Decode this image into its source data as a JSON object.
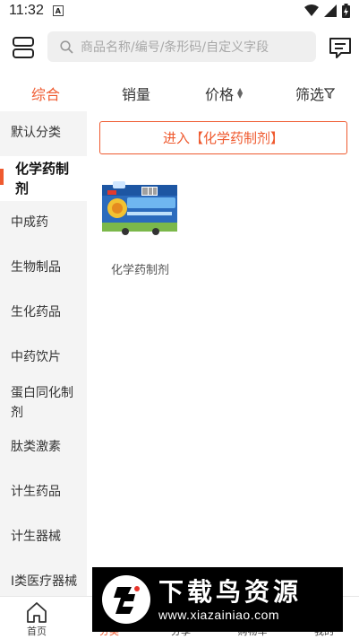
{
  "status_bar": {
    "time": "11:32",
    "app_badge": "A"
  },
  "header": {
    "search_placeholder": "商品名称/编号/条形码/自定义字段"
  },
  "sort_tabs": [
    {
      "label": "综合",
      "active": true
    },
    {
      "label": "销量",
      "active": false
    },
    {
      "label": "价格",
      "active": false
    },
    {
      "label": "筛选",
      "active": false
    }
  ],
  "categories": [
    {
      "label": "默认分类"
    },
    {
      "label": "化学药制剂",
      "active": true
    },
    {
      "label": "中成药"
    },
    {
      "label": "生物制品"
    },
    {
      "label": "生化药品"
    },
    {
      "label": "中药饮片"
    },
    {
      "label": "蛋白同化制剂"
    },
    {
      "label": "肽类激素"
    },
    {
      "label": "计生药品"
    },
    {
      "label": "计生器械"
    },
    {
      "label": "I类医疗器械"
    }
  ],
  "content": {
    "enter_label": "进入【化学药制剂】",
    "product_name": "化学药制剂"
  },
  "bottom_nav": [
    {
      "label": "首页"
    },
    {
      "label": "分类",
      "active": true
    },
    {
      "label": "分享"
    },
    {
      "label": "购物车"
    },
    {
      "label": "我的"
    }
  ],
  "watermark": {
    "title": "下载鸟资源",
    "url": "www.xiazainiao.com"
  },
  "colors": {
    "accent": "#ef5a2f",
    "sidebar_bg": "#f4f4f4",
    "search_bg": "#efefef"
  }
}
